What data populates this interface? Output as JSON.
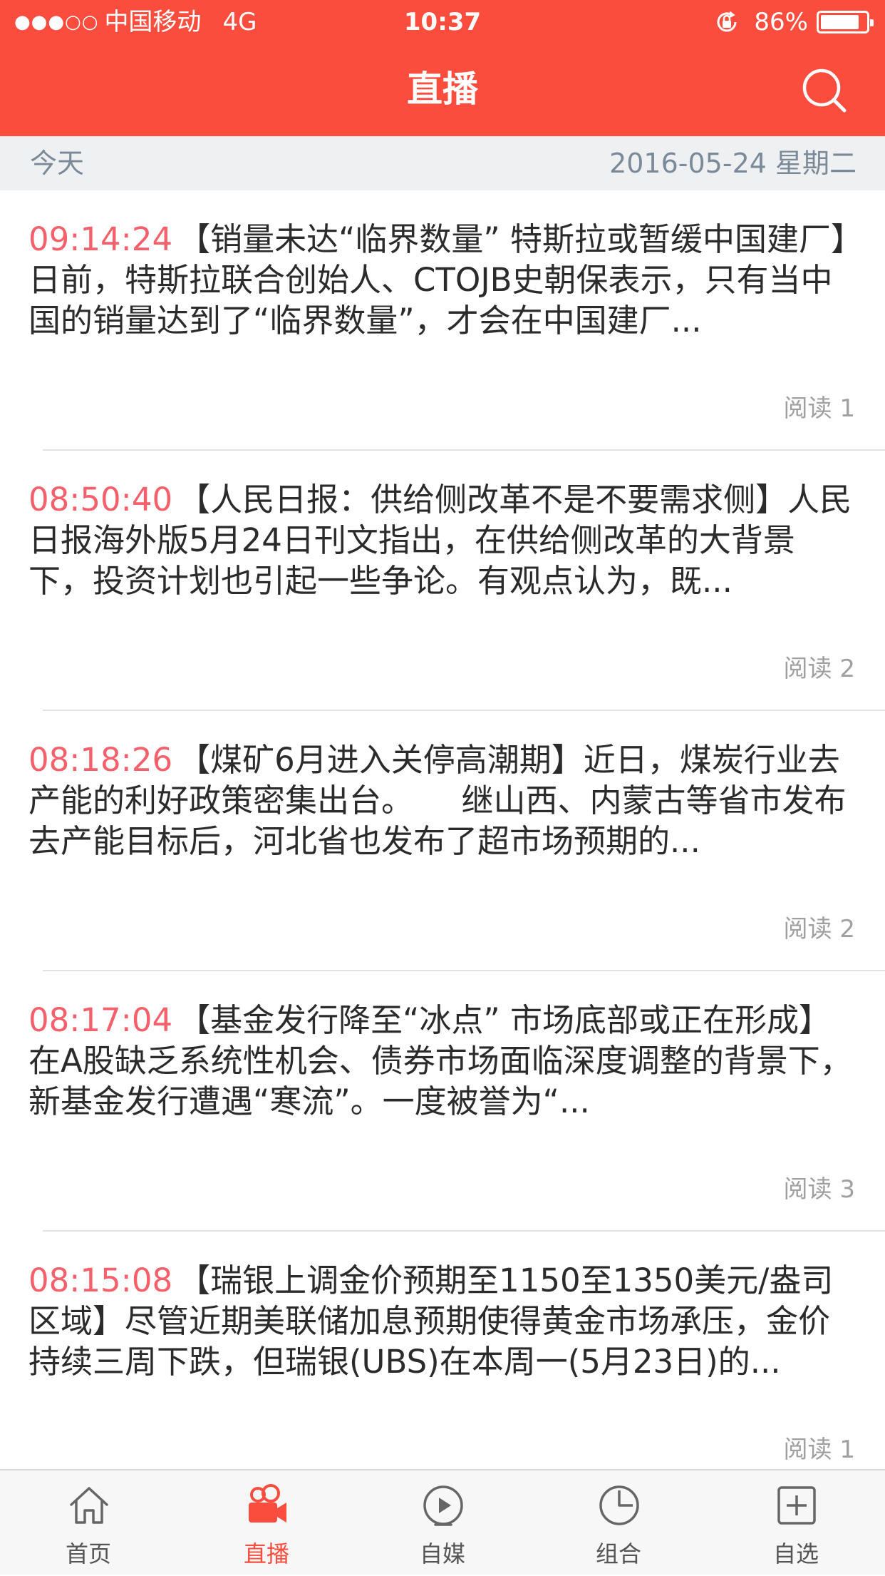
{
  "status_bar": {
    "signal": "●●●○○",
    "carrier": "中国移动",
    "network": "4G",
    "time": "10:37",
    "battery_percent": "86%",
    "battery_level": 0.86
  },
  "navbar": {
    "title": "直播",
    "search_icon": "search-icon"
  },
  "date_bar": {
    "today": "今天",
    "date": "2016-05-24 星期二"
  },
  "feed": [
    {
      "time": "09:14:24",
      "text": "【销量未达“临界数量” 特斯拉或暂缓中国建厂】日前，特斯拉联合创始人、CTOJB史朝保表示，只有当中国的销量达到了“临界数量”，才会在中国建厂...",
      "reads": "阅读 1"
    },
    {
      "time": "08:50:40",
      "text": "【人民日报：供给侧改革不是不要需求侧】人民日报海外版5月24日刊文指出，在供给侧改革的大背景下，投资计划也引起一些争论。有观点认为，既...",
      "reads": "阅读 2"
    },
    {
      "time": "08:18:26",
      "text": "【煤矿6月进入关停高潮期】近日，煤炭行业去产能的利好政策密集出台。　　继山西、内蒙古等省市发布去产能目标后，河北省也发布了超市场预期的...",
      "reads": "阅读 2"
    },
    {
      "time": "08:17:04",
      "text": "【基金发行降至“冰点” 市场底部或正在形成】　　在A股缺乏系统性机会、债券市场面临深度调整的背景下，新基金发行遭遇“寒流”。一度被誉为“...",
      "reads": "阅读 3"
    },
    {
      "time": "08:15:08",
      "text": "【瑞银上调金价预期至1150至1350美元/盎司区域】尽管近期美联储加息预期使得黄金市场承压，金价持续三周下跌，但瑞银(UBS)在本周一(5月23日)的...",
      "reads": "阅读 1"
    }
  ],
  "tabbar": [
    {
      "label": "首页",
      "icon": "home-icon",
      "active": false
    },
    {
      "label": "直播",
      "icon": "video-camera-icon",
      "active": true
    },
    {
      "label": "自媒",
      "icon": "play-circle-icon",
      "active": false
    },
    {
      "label": "组合",
      "icon": "pie-chart-icon",
      "active": false
    },
    {
      "label": "自选",
      "icon": "add-square-icon",
      "active": false
    }
  ],
  "colors": {
    "brand": "#fa4d3e",
    "timestamp": "#f5606a",
    "date_bar_bg": "#eff0f2",
    "tab_inactive": "#555555"
  }
}
